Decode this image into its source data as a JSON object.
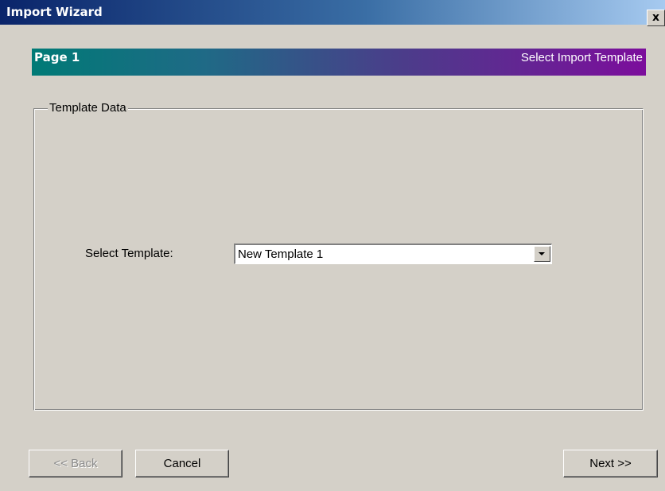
{
  "window": {
    "title": "Import Wizard",
    "close_label": "x"
  },
  "header": {
    "page_label": "Page 1",
    "subtitle": "Select Import Template"
  },
  "group": {
    "label": "Template Data"
  },
  "template_select": {
    "label": "Select Template:",
    "value": "New Template 1"
  },
  "buttons": {
    "back": "<< Back",
    "cancel": "Cancel",
    "next": "Next >>"
  },
  "colors": {
    "window_bg": "#d4d0c8",
    "title_gradient_start": "#0a246a",
    "title_gradient_end": "#a6caf0",
    "header_gradient_start": "#007a76",
    "header_gradient_end": "#7c0d9c"
  },
  "icons": {
    "close": "close-icon",
    "dropdown": "chevron-down-icon"
  }
}
